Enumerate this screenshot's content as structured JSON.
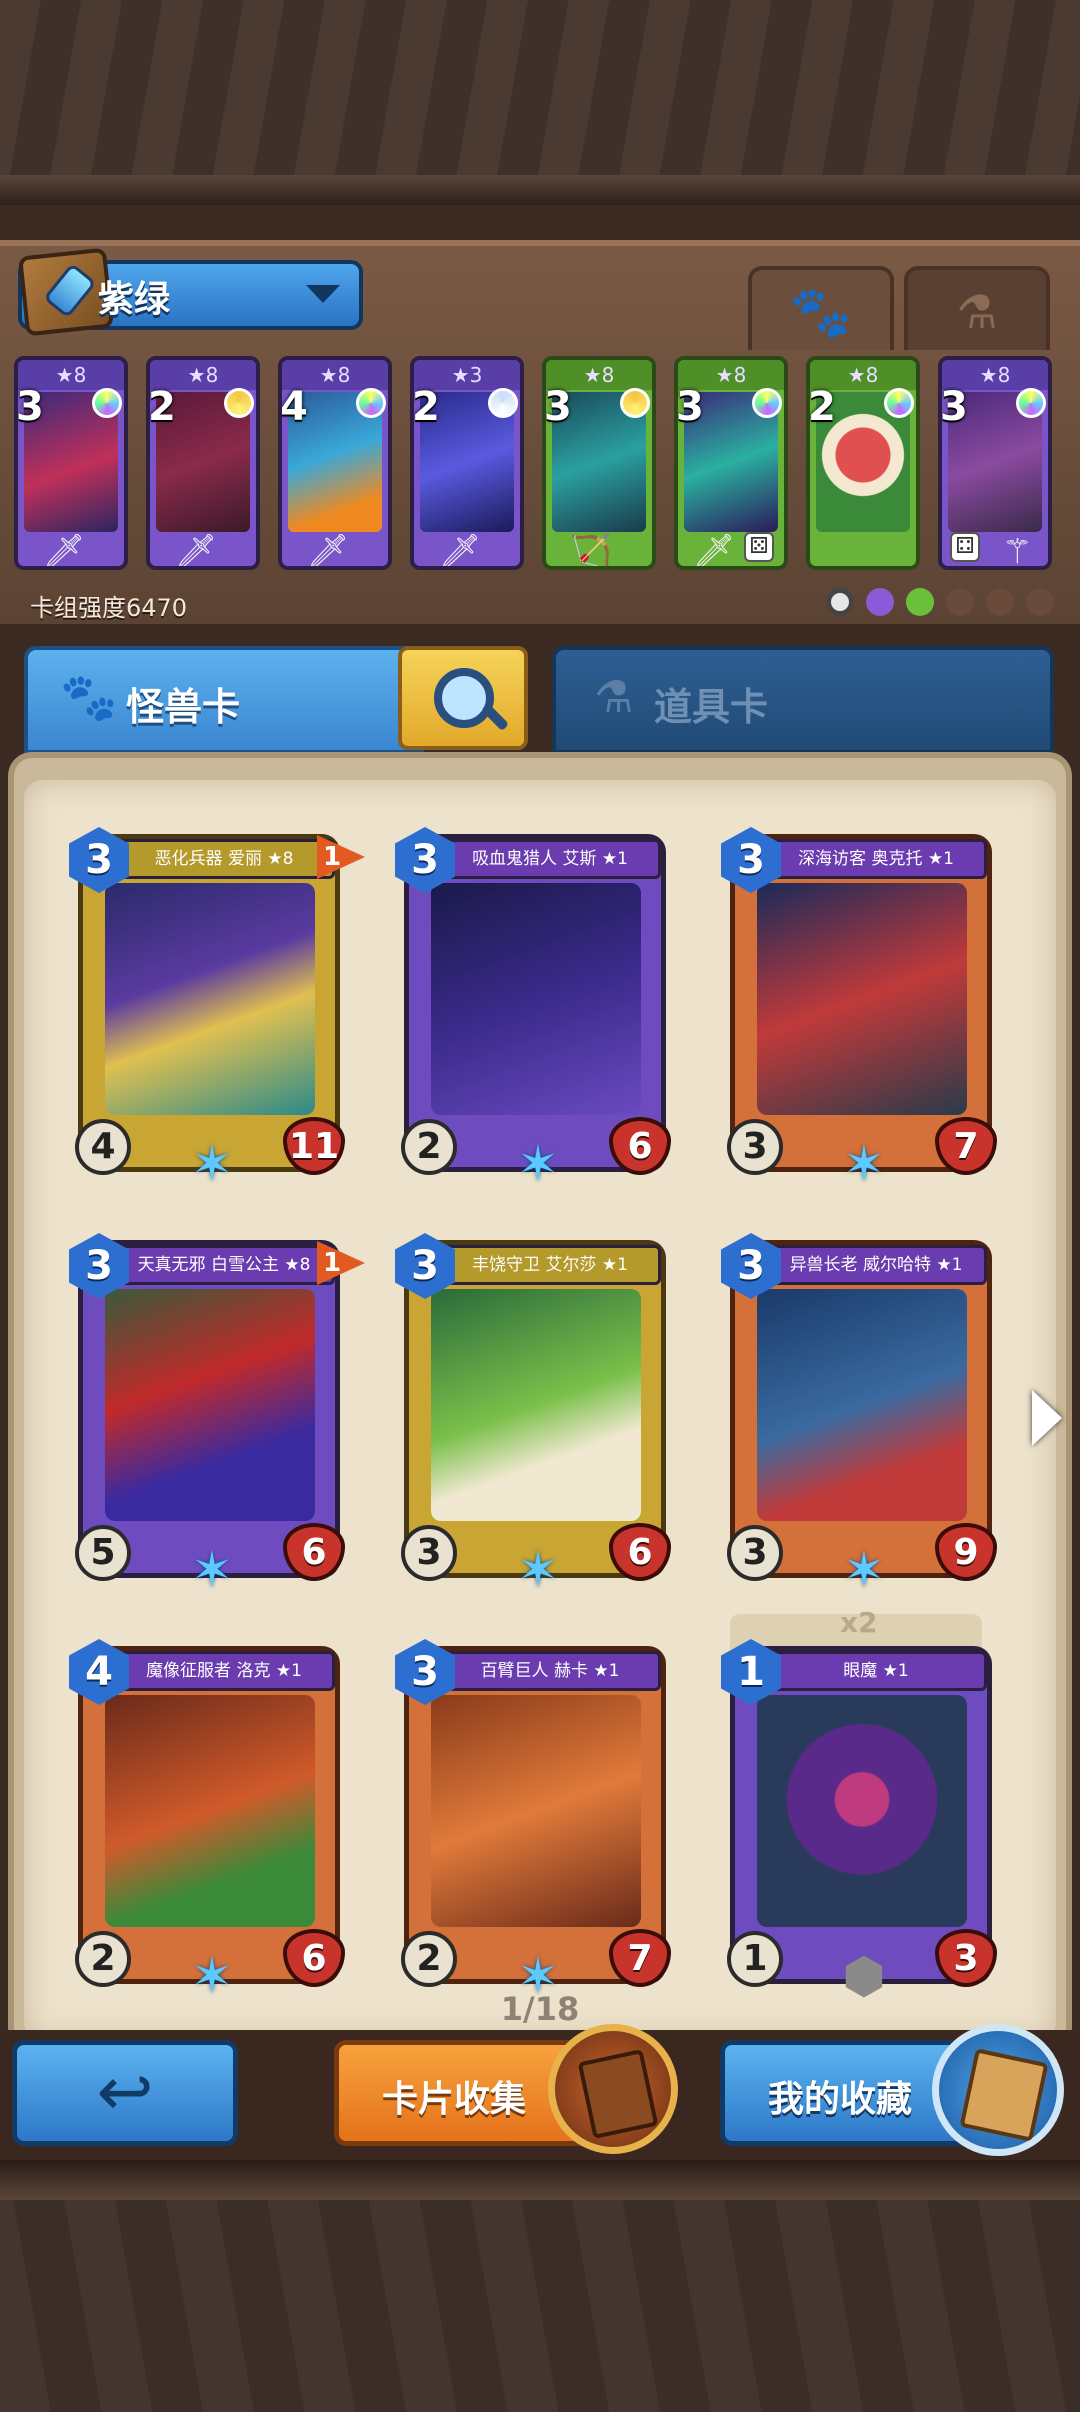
{
  "deck": {
    "name": "紫绿",
    "power_label": "卡组强度6470",
    "cards": [
      {
        "level": "★8",
        "cost": "3",
        "weapon": "sword-icon",
        "color": "purple"
      },
      {
        "level": "★8",
        "cost": "2",
        "weapon": "sword-icon",
        "color": "purple"
      },
      {
        "level": "★8",
        "cost": "4",
        "weapon": "sword-icon",
        "color": "purple"
      },
      {
        "level": "★3",
        "cost": "2",
        "weapon": "sword-icon",
        "color": "purple"
      },
      {
        "level": "★8",
        "cost": "3",
        "weapon": "bow-icon",
        "color": "green"
      },
      {
        "level": "★8",
        "cost": "3",
        "weapon": "sword-icon",
        "color": "green"
      },
      {
        "level": "★8",
        "cost": "2",
        "weapon": "none",
        "color": "green"
      },
      {
        "level": "★8",
        "cost": "3",
        "weapon": "staff-icon",
        "color": "purple"
      }
    ]
  },
  "tabs": {
    "monster": "怪兽卡",
    "item": "道具卡"
  },
  "cards": [
    {
      "name": "恶化兵器 爱丽 ★8",
      "cost": "3",
      "atk": "4",
      "hp": "11",
      "flag": "1",
      "color": "gold"
    },
    {
      "name": "吸血鬼猎人 艾斯 ★1",
      "cost": "3",
      "atk": "2",
      "hp": "6",
      "flag": "",
      "color": "purple"
    },
    {
      "name": "深海访客 奥克托 ★1",
      "cost": "3",
      "atk": "3",
      "hp": "7",
      "flag": "",
      "color": "purple"
    },
    {
      "name": "天真无邪 白雪公主 ★8",
      "cost": "3",
      "atk": "5",
      "hp": "6",
      "flag": "1",
      "color": "purple"
    },
    {
      "name": "丰饶守卫 艾尔莎 ★1",
      "cost": "3",
      "atk": "3",
      "hp": "6",
      "flag": "",
      "color": "green"
    },
    {
      "name": "异兽长老 威尔哈特 ★1",
      "cost": "3",
      "atk": "3",
      "hp": "9",
      "flag": "",
      "color": "green"
    },
    {
      "name": "魔像征服者 洛克 ★1",
      "cost": "4",
      "atk": "2",
      "hp": "6",
      "flag": "",
      "color": "green"
    },
    {
      "name": "百臂巨人 赫卡 ★1",
      "cost": "3",
      "atk": "2",
      "hp": "7",
      "flag": "",
      "color": "gold"
    },
    {
      "name": "眼魔 ★1",
      "cost": "1",
      "atk": "1",
      "hp": "3",
      "flag": "",
      "color": "purple"
    }
  ],
  "duplicate_label": "x2",
  "pagination": "1/18",
  "buttons": {
    "collect": "卡片收集",
    "favorites": "我的收藏"
  }
}
